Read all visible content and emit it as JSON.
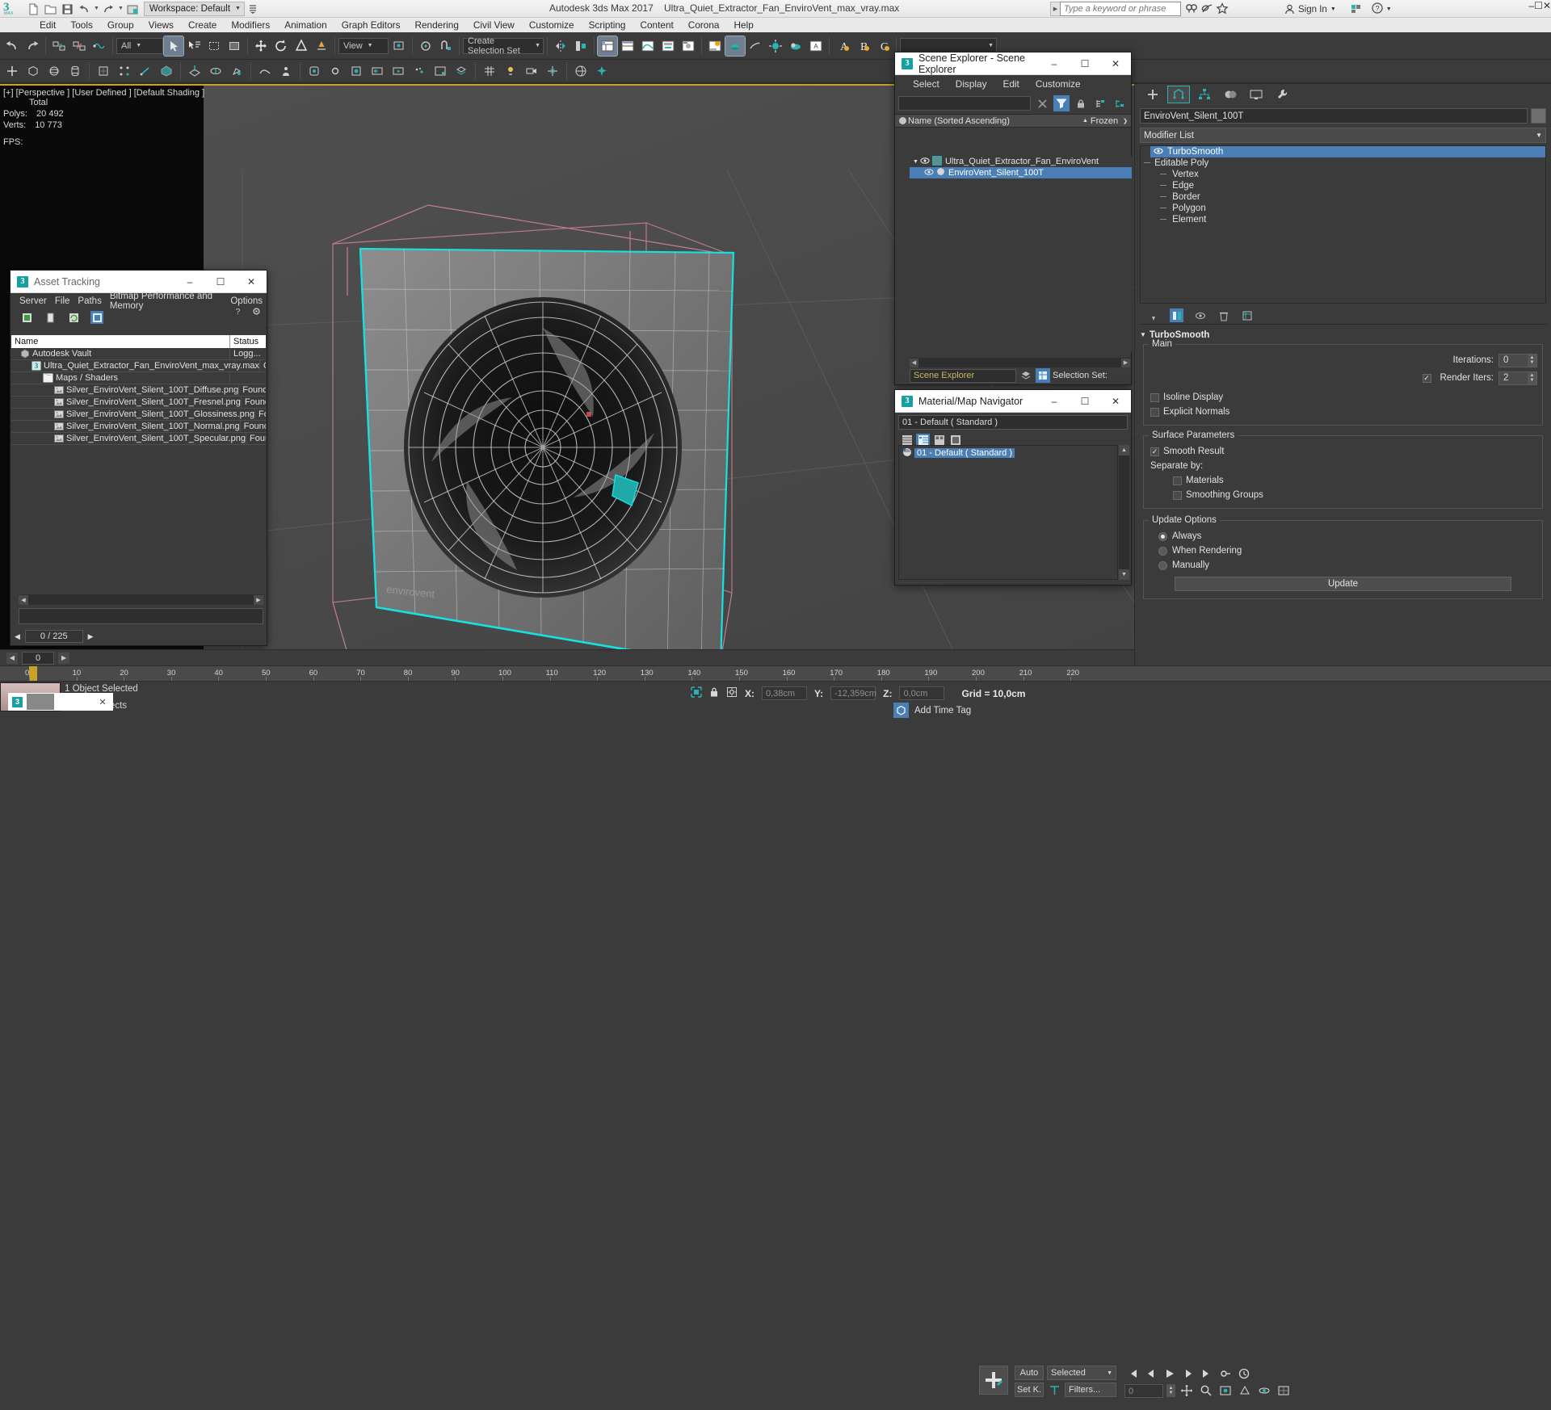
{
  "titlebar": {
    "app_title": "Autodesk 3ds Max 2017",
    "file_name": "Ultra_Quiet_Extractor_Fan_EnviroVent_max_vray.max",
    "workspace": "Workspace: Default",
    "search_placeholder": "Type a keyword or phrase",
    "sign_in": "Sign In",
    "quick_access": [
      "new-file-icon",
      "open-file-icon",
      "save-icon",
      "undo-icon",
      "redo-icon",
      "set-project-folder-icon"
    ],
    "right_icons": [
      "help-search-icon",
      "communication-center-icon",
      "favorites-star-icon"
    ],
    "window_controls": {
      "minimize": "–",
      "maximize": "☐",
      "close": "✕"
    }
  },
  "menubar": [
    "Edit",
    "Tools",
    "Group",
    "Views",
    "Create",
    "Modifiers",
    "Animation",
    "Graph Editors",
    "Rendering",
    "Civil View",
    "Customize",
    "Scripting",
    "Content",
    "Corona",
    "Help"
  ],
  "toolbar": {
    "selection_filter": "All",
    "view_combo": "View",
    "named_selection_set": "Create Selection Set"
  },
  "viewport": {
    "label": "[+] [Perspective ] [User Defined ] [Default Shading ]",
    "total_label": "Total",
    "polys_label": "Polys:",
    "polys_value": "20 492",
    "verts_label": "Verts:",
    "verts_value": "10 773",
    "fps_label": "FPS:"
  },
  "scene_explorer": {
    "title": "Scene Explorer - Scene Explorer",
    "menu": [
      "Select",
      "Display",
      "Edit",
      "Customize"
    ],
    "filter_value": "",
    "column_name": "Name (Sorted Ascending)",
    "column_frozen": "Frozen",
    "items": [
      {
        "label": "Ultra_Quiet_Extractor_Fan_EnviroVent",
        "selected": false,
        "depth": 0
      },
      {
        "label": "EnviroVent_Silent_100T",
        "selected": true,
        "depth": 1
      }
    ],
    "footer_name": "Scene Explorer",
    "selection_set_label": "Selection Set:"
  },
  "material_navigator": {
    "title": "Material/Map Navigator",
    "current_material": "01 - Default  ( Standard )",
    "items": [
      {
        "label": "01 - Default  ( Standard )",
        "selected": true
      }
    ]
  },
  "asset_tracking": {
    "title": "Asset Tracking",
    "menu": [
      "Server",
      "File",
      "Paths",
      "Bitmap Performance and Memory",
      "Options"
    ],
    "columns": {
      "name": "Name",
      "status": "Status"
    },
    "rows": [
      {
        "name": "Autodesk Vault",
        "status": "Logg...",
        "depth": 0,
        "icon": "vault-icon"
      },
      {
        "name": "Ultra_Quiet_Extractor_Fan_EnviroVent_max_vray.max",
        "status": "Ok",
        "depth": 1,
        "icon": "max-file-icon"
      },
      {
        "name": "Maps / Shaders",
        "status": "",
        "depth": 2,
        "icon": "folder-icon"
      },
      {
        "name": "Silver_EnviroVent_Silent_100T_Diffuse.png",
        "status": "Found",
        "depth": 3,
        "icon": "bitmap-icon"
      },
      {
        "name": "Silver_EnviroVent_Silent_100T_Fresnel.png",
        "status": "Found",
        "depth": 3,
        "icon": "bitmap-icon"
      },
      {
        "name": "Silver_EnviroVent_Silent_100T_Glossiness.png",
        "status": "Found",
        "depth": 3,
        "icon": "bitmap-icon"
      },
      {
        "name": "Silver_EnviroVent_Silent_100T_Normal.png",
        "status": "Found",
        "depth": 3,
        "icon": "bitmap-icon"
      },
      {
        "name": "Silver_EnviroVent_Silent_100T_Specular.png",
        "status": "Found",
        "depth": 3,
        "icon": "bitmap-icon"
      }
    ],
    "status_count": "0 / 225",
    "path_value": ""
  },
  "command_panel": {
    "object_name": "EnviroVent_Silent_100T",
    "modifier_list_label": "Modifier List",
    "stack": [
      {
        "label": "TurboSmooth",
        "selected": true,
        "sub": false
      },
      {
        "label": "Editable Poly",
        "selected": false,
        "sub": false
      },
      {
        "label": "Vertex",
        "selected": false,
        "sub": true
      },
      {
        "label": "Edge",
        "selected": false,
        "sub": true
      },
      {
        "label": "Border",
        "selected": false,
        "sub": true
      },
      {
        "label": "Polygon",
        "selected": false,
        "sub": true
      },
      {
        "label": "Element",
        "selected": false,
        "sub": true
      }
    ],
    "rollout_title": "TurboSmooth",
    "main_group": "Main",
    "iterations_label": "Iterations:",
    "iterations_value": "0",
    "render_iters_label": "Render Iters:",
    "render_iters_value": "2",
    "render_iters_checked": true,
    "isoline_display": "Isoline Display",
    "isoline_checked": false,
    "explicit_normals": "Explicit Normals",
    "explicit_checked": false,
    "surface_params_group": "Surface Parameters",
    "smooth_result": "Smooth Result",
    "smooth_result_checked": true,
    "separate_by": "Separate by:",
    "materials": "Materials",
    "materials_checked": false,
    "smoothing_groups": "Smoothing Groups",
    "smoothing_groups_checked": false,
    "update_options_group": "Update Options",
    "update_always": "Always",
    "update_when_rendering": "When Rendering",
    "update_manually": "Manually",
    "update_selected": "Always",
    "update_button": "Update"
  },
  "timeline": {
    "frame_value": "0",
    "ticks": [
      "0",
      "10",
      "20",
      "30",
      "40",
      "50",
      "60",
      "70",
      "80",
      "90",
      "100",
      "110",
      "120",
      "130",
      "140",
      "150",
      "160",
      "170",
      "180",
      "190",
      "200",
      "210",
      "220"
    ]
  },
  "statusbar": {
    "selection_text": "1 Object Selected",
    "prompt": "ck-and-drag to select objects",
    "x_label": "X:",
    "x_value": "0,38cm",
    "y_label": "Y:",
    "y_value": "-12,359cm",
    "z_label": "Z:",
    "z_value": "0,0cm",
    "grid": "Grid = 10,0cm",
    "add_time_tag": "Add Time Tag",
    "auto_key": "Auto",
    "set_key": "Set K.",
    "selected_combo": "Selected",
    "filters": "Filters...",
    "key_field": "0"
  },
  "taskbar": {
    "window_label": ""
  },
  "colors": {
    "accent_teal": "#2bb3b3",
    "select_blue": "#4a7fb5",
    "panel_bg": "#3b3b3b",
    "viewport_bg": "#4a4a4a",
    "highlight_cyan": "#18e0e0",
    "gizmo_yellow": "#c9a227",
    "pink_bbox": "#c87d93"
  }
}
